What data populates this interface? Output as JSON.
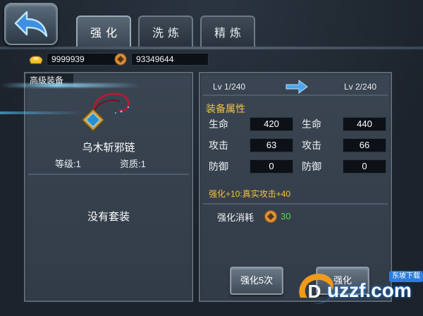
{
  "tabs": [
    {
      "label": "强化",
      "active": true
    },
    {
      "label": "洗炼",
      "active": false
    },
    {
      "label": "精炼",
      "active": false
    }
  ],
  "currency": {
    "gold": "9999939",
    "coins": "93349644"
  },
  "item": {
    "category_label": "高级装备",
    "name": "乌木斩邪链",
    "level": "等级:1",
    "quality": "资质:1",
    "set_text": "没有套装"
  },
  "upgrade": {
    "current_level": "Lv 1/240",
    "next_level": "Lv 2/240",
    "attr_title": "装备属性",
    "attributes": [
      {
        "name": "生命",
        "current": "420",
        "next_name": "生命",
        "next": "440"
      },
      {
        "name": "攻击",
        "current": "63",
        "next_name": "攻击",
        "next": "66"
      },
      {
        "name": "防御",
        "current": "0",
        "next_name": "防御",
        "next": "0"
      }
    ],
    "bonus_text": "强化+10:真实攻击+40",
    "cost_label": "强化消耗",
    "cost_value": "30"
  },
  "buttons": {
    "enhance_5": "强化5次",
    "enhance_1": "强化"
  },
  "watermark": {
    "text": "uzzf.com",
    "tag": "东坡下载"
  },
  "colors": {
    "accent_gold": "#f5c042",
    "cost_green": "#5fd64a",
    "arrow_blue": "#4aa6f0"
  },
  "icons": {
    "back": "back-arrow-icon",
    "gold": "gold-ingot-icon",
    "coin": "coin-icon",
    "arrow": "arrow-right-icon",
    "item": "necklace-icon"
  }
}
